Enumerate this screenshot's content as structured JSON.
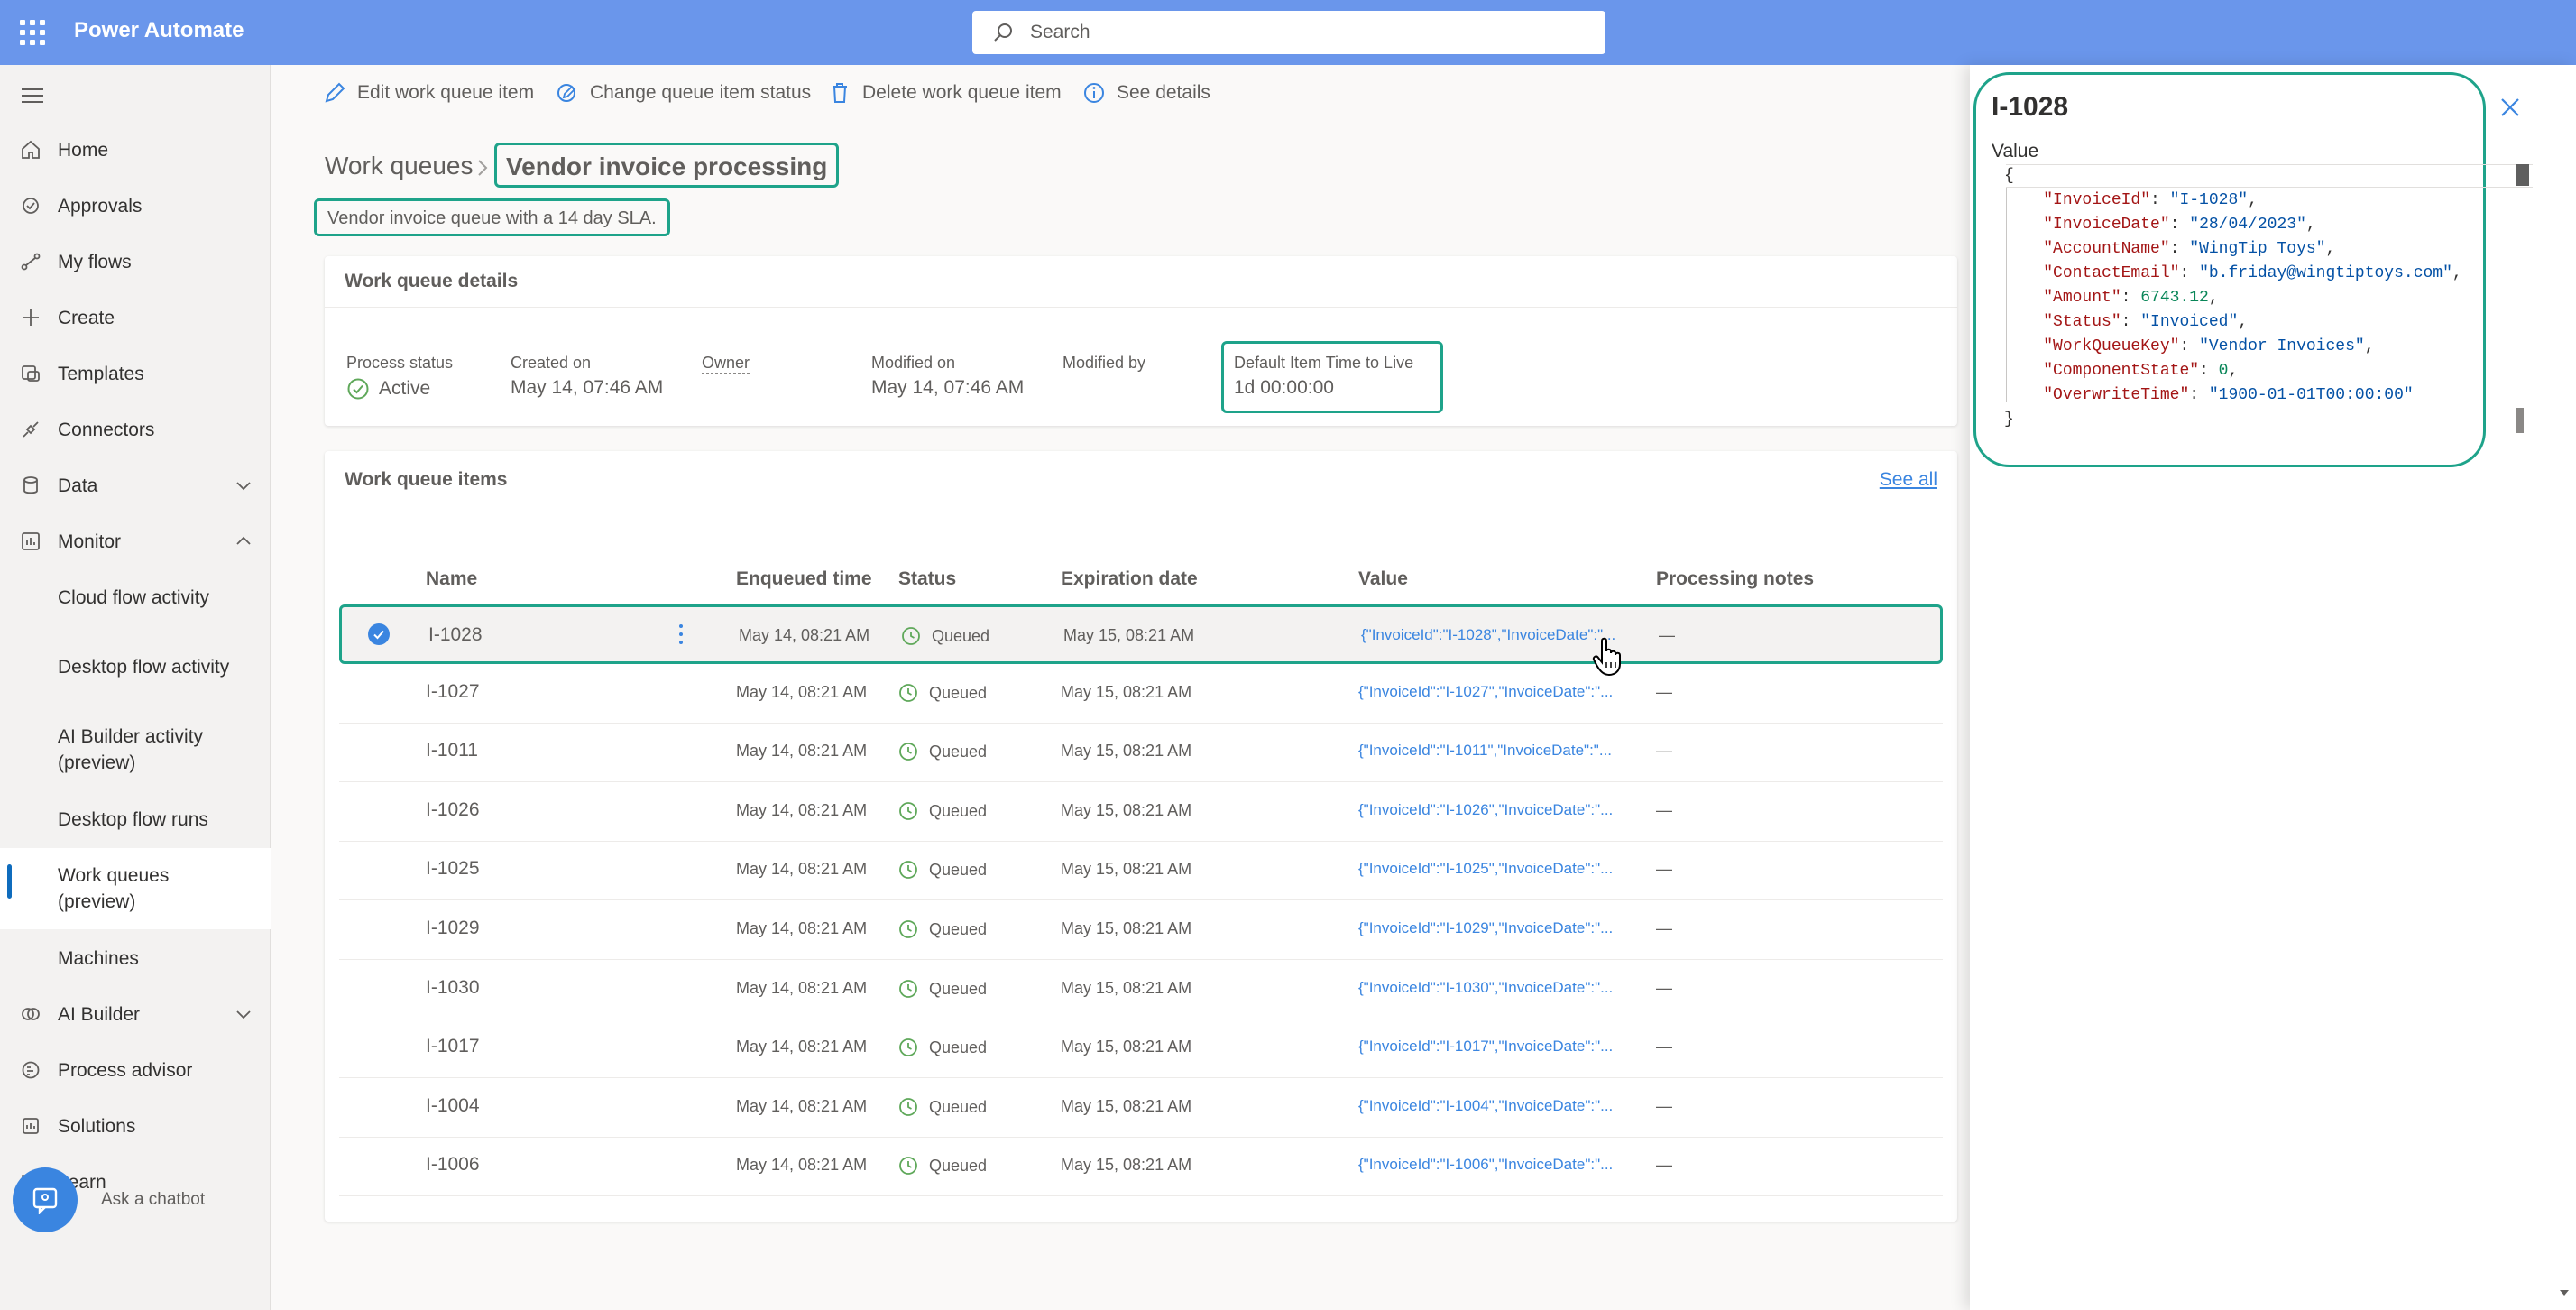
{
  "app": {
    "title": "Power Automate"
  },
  "search": {
    "placeholder": "Search"
  },
  "sidebar": {
    "items": [
      {
        "label": "Home",
        "icon": "home-icon"
      },
      {
        "label": "Approvals",
        "icon": "approvals-icon"
      },
      {
        "label": "My flows",
        "icon": "flows-icon"
      },
      {
        "label": "Create",
        "icon": "plus-icon"
      },
      {
        "label": "Templates",
        "icon": "templates-icon"
      },
      {
        "label": "Connectors",
        "icon": "connectors-icon"
      },
      {
        "label": "Data",
        "icon": "data-icon"
      },
      {
        "label": "Monitor",
        "icon": "monitor-icon"
      },
      {
        "label": "Cloud flow activity"
      },
      {
        "label": "Desktop flow activity"
      },
      {
        "label": "AI Builder activity (preview)"
      },
      {
        "label": "Desktop flow runs"
      },
      {
        "label": "Work queues (preview)"
      },
      {
        "label": "Machines"
      },
      {
        "label": "AI Builder",
        "icon": "ai-builder-icon"
      },
      {
        "label": "Process advisor",
        "icon": "process-advisor-icon"
      },
      {
        "label": "Solutions",
        "icon": "solutions-icon"
      },
      {
        "label": "Learn",
        "icon": "learn-icon"
      }
    ],
    "chatbot_label": "Ask a chatbot"
  },
  "commands": {
    "edit": "Edit work queue item",
    "change_status": "Change queue item status",
    "delete": "Delete work queue item",
    "details": "See details"
  },
  "breadcrumb": {
    "parent": "Work queues",
    "current": "Vendor invoice processing"
  },
  "description": "Vendor invoice queue with a 14 day SLA.",
  "details": {
    "title": "Work queue details",
    "process_status_label": "Process status",
    "process_status_value": "Active",
    "created_label": "Created on",
    "created_value": "May 14, 07:46 AM",
    "owner_label": "Owner",
    "modified_label": "Modified on",
    "modified_value": "May 14, 07:46 AM",
    "modified_by_label": "Modified by",
    "ttl_label": "Default Item Time to Live",
    "ttl_value": "1d 00:00:00"
  },
  "items": {
    "title": "Work queue items",
    "see_all": "See all",
    "columns": [
      "Name",
      "Enqueued time",
      "Status",
      "Expiration date",
      "Value",
      "Processing notes"
    ],
    "rows": [
      {
        "name": "I-1028",
        "enqueued": "May 14, 08:21 AM",
        "status": "Queued",
        "expiration": "May 15, 08:21 AM",
        "value": "{\"InvoiceId\":\"I-1028\",\"InvoiceDate\":\"...",
        "notes": "—"
      },
      {
        "name": "I-1027",
        "enqueued": "May 14, 08:21 AM",
        "status": "Queued",
        "expiration": "May 15, 08:21 AM",
        "value": "{\"InvoiceId\":\"I-1027\",\"InvoiceDate\":\"...",
        "notes": "—"
      },
      {
        "name": "I-1011",
        "enqueued": "May 14, 08:21 AM",
        "status": "Queued",
        "expiration": "May 15, 08:21 AM",
        "value": "{\"InvoiceId\":\"I-1011\",\"InvoiceDate\":\"...",
        "notes": "—"
      },
      {
        "name": "I-1026",
        "enqueued": "May 14, 08:21 AM",
        "status": "Queued",
        "expiration": "May 15, 08:21 AM",
        "value": "{\"InvoiceId\":\"I-1026\",\"InvoiceDate\":\"...",
        "notes": "—"
      },
      {
        "name": "I-1025",
        "enqueued": "May 14, 08:21 AM",
        "status": "Queued",
        "expiration": "May 15, 08:21 AM",
        "value": "{\"InvoiceId\":\"I-1025\",\"InvoiceDate\":\"...",
        "notes": "—"
      },
      {
        "name": "I-1029",
        "enqueued": "May 14, 08:21 AM",
        "status": "Queued",
        "expiration": "May 15, 08:21 AM",
        "value": "{\"InvoiceId\":\"I-1029\",\"InvoiceDate\":\"...",
        "notes": "—"
      },
      {
        "name": "I-1030",
        "enqueued": "May 14, 08:21 AM",
        "status": "Queued",
        "expiration": "May 15, 08:21 AM",
        "value": "{\"InvoiceId\":\"I-1030\",\"InvoiceDate\":\"...",
        "notes": "—"
      },
      {
        "name": "I-1017",
        "enqueued": "May 14, 08:21 AM",
        "status": "Queued",
        "expiration": "May 15, 08:21 AM",
        "value": "{\"InvoiceId\":\"I-1017\",\"InvoiceDate\":\"...",
        "notes": "—"
      },
      {
        "name": "I-1004",
        "enqueued": "May 14, 08:21 AM",
        "status": "Queued",
        "expiration": "May 15, 08:21 AM",
        "value": "{\"InvoiceId\":\"I-1004\",\"InvoiceDate\":\"...",
        "notes": "—"
      },
      {
        "name": "I-1006",
        "enqueued": "May 14, 08:21 AM",
        "status": "Queued",
        "expiration": "May 15, 08:21 AM",
        "value": "{\"InvoiceId\":\"I-1006\",\"InvoiceDate\":\"...",
        "notes": "—"
      }
    ]
  },
  "panel": {
    "title": "I-1028",
    "value_label": "Value",
    "json_open": "{",
    "json_close": "}",
    "fields": [
      {
        "key": "\"InvoiceId\"",
        "value": "\"I-1028\"",
        "type": "string"
      },
      {
        "key": "\"InvoiceDate\"",
        "value": "\"28/04/2023\"",
        "type": "string"
      },
      {
        "key": "\"AccountName\"",
        "value": "\"WingTip Toys\"",
        "type": "string"
      },
      {
        "key": "\"ContactEmail\"",
        "value": "\"b.friday@wingtiptoys.com\"",
        "type": "string"
      },
      {
        "key": "\"Amount\"",
        "value": "6743.12",
        "type": "number"
      },
      {
        "key": "\"Status\"",
        "value": "\"Invoiced\"",
        "type": "string"
      },
      {
        "key": "\"WorkQueueKey\"",
        "value": "\"Vendor Invoices\"",
        "type": "string"
      },
      {
        "key": "\"ComponentState\"",
        "value": "0",
        "type": "number"
      },
      {
        "key": "\"OverwriteTime\"",
        "value": "\"1900-01-01T00:00:00\"",
        "type": "string"
      }
    ]
  },
  "colors": {
    "accent": "#0f6cbd",
    "highlight": "#1ea38a",
    "topbar": "#6a96eb",
    "link": "#3a85e0",
    "status_green": "#5fa85a"
  }
}
